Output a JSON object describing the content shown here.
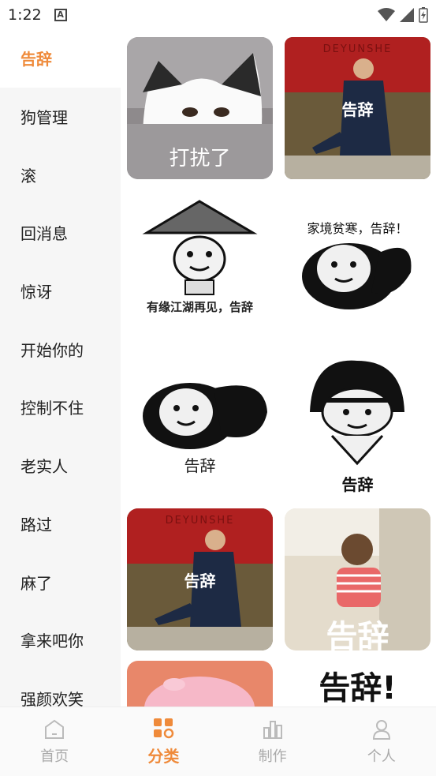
{
  "status": {
    "time": "1:22",
    "notif_icon": "A"
  },
  "sidebar": {
    "items": [
      {
        "label": "告辞",
        "active": true
      },
      {
        "label": "狗管理"
      },
      {
        "label": "滚"
      },
      {
        "label": "回消息"
      },
      {
        "label": "惊讶"
      },
      {
        "label": "开始你的"
      },
      {
        "label": "控制不住"
      },
      {
        "label": "老实人"
      },
      {
        "label": "路过"
      },
      {
        "label": "麻了"
      },
      {
        "label": "拿来吧你"
      },
      {
        "label": "强颜欢笑"
      }
    ]
  },
  "stickers": [
    {
      "caption": "打扰了"
    },
    {
      "caption": "告辞",
      "sign": "DEYUNSHE"
    },
    {
      "caption": "有缘江湖再见，告辞"
    },
    {
      "caption": "家境贫寒，告辞！"
    },
    {
      "caption": "告辞"
    },
    {
      "caption": "告辞"
    },
    {
      "caption": "告辞",
      "sign": "DEYUNSHE"
    },
    {
      "caption": "告辞"
    },
    {
      "caption": ""
    },
    {
      "caption": "告辞!"
    }
  ],
  "tabbar": {
    "tabs": [
      {
        "label": "首页",
        "icon": "home-icon"
      },
      {
        "label": "分类",
        "icon": "category-icon",
        "active": true
      },
      {
        "label": "制作",
        "icon": "make-icon"
      },
      {
        "label": "个人",
        "icon": "profile-icon"
      }
    ]
  },
  "colors": {
    "accent": "#ef8a3a",
    "sidebar_bg": "#f6f6f6"
  }
}
